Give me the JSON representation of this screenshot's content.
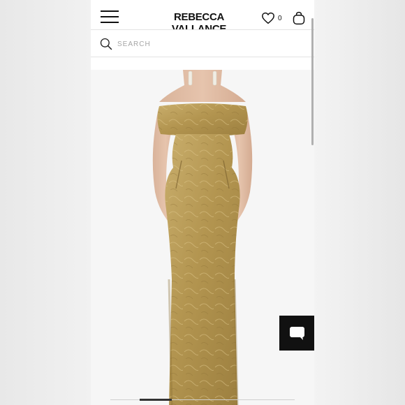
{
  "header": {
    "logo": "REBECCA VALLANCE",
    "wishlist_count": "0",
    "icons": [
      "menu-icon",
      "heart-icon",
      "bag-icon"
    ]
  },
  "search": {
    "placeholder": "SEARCH",
    "icon": "search-icon"
  },
  "product": {
    "image": "gold-jacquard-off-shoulder-gown-photo"
  },
  "chat": {
    "icon": "chat-bubble-icon",
    "background_color": "#111111"
  },
  "colors": {
    "gown_gold": "#b79a56",
    "text": "#111111",
    "page_background": "#ebebeb"
  }
}
